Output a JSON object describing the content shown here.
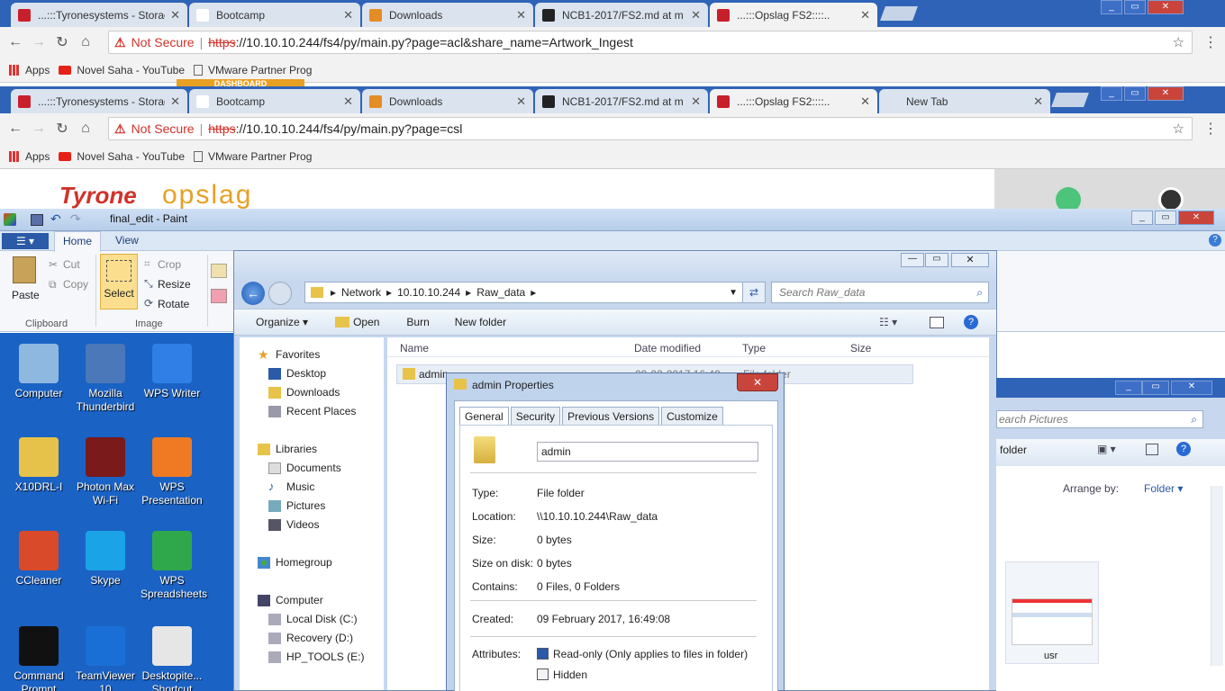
{
  "browser1": {
    "tabs": [
      {
        "title": "...:::Tyronesystems - Storag",
        "color": "#c8202a"
      },
      {
        "title": "Bootcamp",
        "color": "#ffffff"
      },
      {
        "title": "Downloads",
        "color": "#e48d24"
      },
      {
        "title": "NCB1-2017/FS2.md at m",
        "color": "#222222"
      },
      {
        "title": "...:::Opslag FS2::::..",
        "color": "#c8202a"
      }
    ],
    "not_secure": "Not Secure",
    "url_scheme": "https",
    "url_rest": "://10.10.10.244/fs4/py/main.py?page=acl&share_name=Artwork_Ingest"
  },
  "browser2": {
    "tabs": [
      {
        "title": "...:::Tyronesystems - Storag",
        "color": "#c8202a"
      },
      {
        "title": "Bootcamp",
        "color": "#ffffff"
      },
      {
        "title": "Downloads",
        "color": "#e48d24"
      },
      {
        "title": "NCB1-2017/FS2.md at m",
        "color": "#222222"
      },
      {
        "title": "...:::Opslag FS2::::..",
        "color": "#c8202a"
      },
      {
        "title": "New Tab",
        "color": "#dbe3ee"
      }
    ],
    "not_secure": "Not Secure",
    "url_scheme": "https",
    "url_rest": "://10.10.10.244/fs4/py/main.py?page=csl"
  },
  "bookmarks": {
    "apps": "Apps",
    "items": [
      "Novel Saha - YouTube",
      "VMware Partner Prog"
    ]
  },
  "banner": {
    "dashboard": "DASHBOARD",
    "logo_tyrone": "Tyrone",
    "logo_opslag": "opslag"
  },
  "paint": {
    "title": "final_edit - Paint",
    "tabs": [
      "Home",
      "View"
    ],
    "clipboard": {
      "paste": "Paste",
      "cut": "Cut",
      "copy": "Copy",
      "label": "Clipboard"
    },
    "image": {
      "select": "Select",
      "crop": "Crop",
      "resize": "Resize",
      "rotate": "Rotate",
      "label": "Image"
    }
  },
  "desktop_icons": [
    {
      "label": "Computer",
      "color": "#8fb8e0"
    },
    {
      "label": "Mozilla Thunderbird",
      "color": "#4a78b8"
    },
    {
      "label": "WPS Writer",
      "color": "#2f7fe6"
    },
    {
      "label": "X10DRL-I",
      "color": "#e6c24a"
    },
    {
      "label": "Photon Max Wi-Fi",
      "color": "#7a1a1a"
    },
    {
      "label": "WPS Presentation",
      "color": "#f07a24"
    },
    {
      "label": "CCleaner",
      "color": "#d84a2a"
    },
    {
      "label": "Skype",
      "color": "#1aa3e6"
    },
    {
      "label": "WPS Spreadsheets",
      "color": "#2ea84a"
    },
    {
      "label": "Command Prompt",
      "color": "#111111"
    },
    {
      "label": "TeamViewer 10",
      "color": "#1a6fd6"
    },
    {
      "label": "Desktopite... Shortcut",
      "color": "#e6e6e6"
    }
  ],
  "explorer": {
    "breadcrumb": [
      "Network",
      "10.10.10.244",
      "Raw_data"
    ],
    "search_placeholder": "Search Raw_data",
    "toolbar": {
      "organize": "Organize",
      "open": "Open",
      "burn": "Burn",
      "new_folder": "New folder"
    },
    "columns": [
      "Name",
      "Date modified",
      "Type",
      "Size"
    ],
    "row_name": "admin",
    "row_date": "09-02-2017 16:49",
    "row_type": "File folder",
    "sidebar": {
      "favorites": "Favorites",
      "fav_items": [
        "Desktop",
        "Downloads",
        "Recent Places"
      ],
      "libraries": "Libraries",
      "lib_items": [
        "Documents",
        "Music",
        "Pictures",
        "Videos"
      ],
      "homegroup": "Homegroup",
      "computer": "Computer",
      "comp_items": [
        "Local Disk (C:)",
        "Recovery (D:)",
        "HP_TOOLS (E:)"
      ]
    }
  },
  "dialog": {
    "title": "admin Properties",
    "tabs": [
      "General",
      "Security",
      "Previous Versions",
      "Customize"
    ],
    "name": "admin",
    "rows": [
      {
        "label": "Type:",
        "value": "File folder"
      },
      {
        "label": "Location:",
        "value": "\\\\10.10.10.244\\Raw_data"
      },
      {
        "label": "Size:",
        "value": "0 bytes"
      },
      {
        "label": "Size on disk:",
        "value": "0 bytes"
      },
      {
        "label": "Contains:",
        "value": "0 Files, 0 Folders"
      }
    ],
    "created_label": "Created:",
    "created_value": "09 February 2017, 16:49:08",
    "attributes_label": "Attributes:",
    "readonly": "Read-only (Only applies to files in folder)",
    "hidden": "Hidden"
  },
  "right_window": {
    "search_placeholder": "earch Pictures",
    "folder_fragment": "folder",
    "arrange_by": "Arrange by:",
    "arrange_value": "Folder",
    "thumb_label": "usr"
  }
}
